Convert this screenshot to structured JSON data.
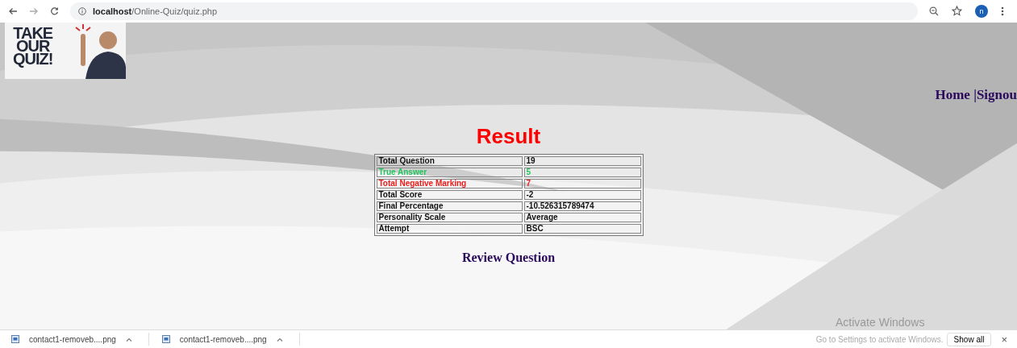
{
  "browser": {
    "url_host": "localhost",
    "url_path": "/Online-Quiz/quiz.php",
    "profile_initial": "n"
  },
  "logo": {
    "words": [
      "TAKE",
      "OUR",
      "QUIZ!"
    ]
  },
  "nav": {
    "links": [
      "Home |",
      "Signou"
    ]
  },
  "heading": "Result",
  "results": [
    {
      "label": "Total Question",
      "value": "19",
      "kind": "normal"
    },
    {
      "label": "True Answer",
      "value": "5",
      "kind": "correct"
    },
    {
      "label": "Total Negative Marking",
      "value": "7",
      "kind": "wrong"
    },
    {
      "label": "Total Score",
      "value": "-2",
      "kind": "normal"
    },
    {
      "label": "Final Percentage",
      "value": "-10.526315789474",
      "kind": "normal"
    },
    {
      "label": "Personality Scale",
      "value": "Average",
      "kind": "normal"
    },
    {
      "label": "Attempt",
      "value": "BSC",
      "kind": "normal"
    }
  ],
  "review_link": "Review Question",
  "os_notice": {
    "title": "Activate Windows",
    "text": "Go to Settings to activate Windows."
  },
  "downloads": {
    "items": [
      "contact1-removeb....png",
      "contact1-removeb....png"
    ],
    "show_all": "Show all",
    "close": "×"
  }
}
